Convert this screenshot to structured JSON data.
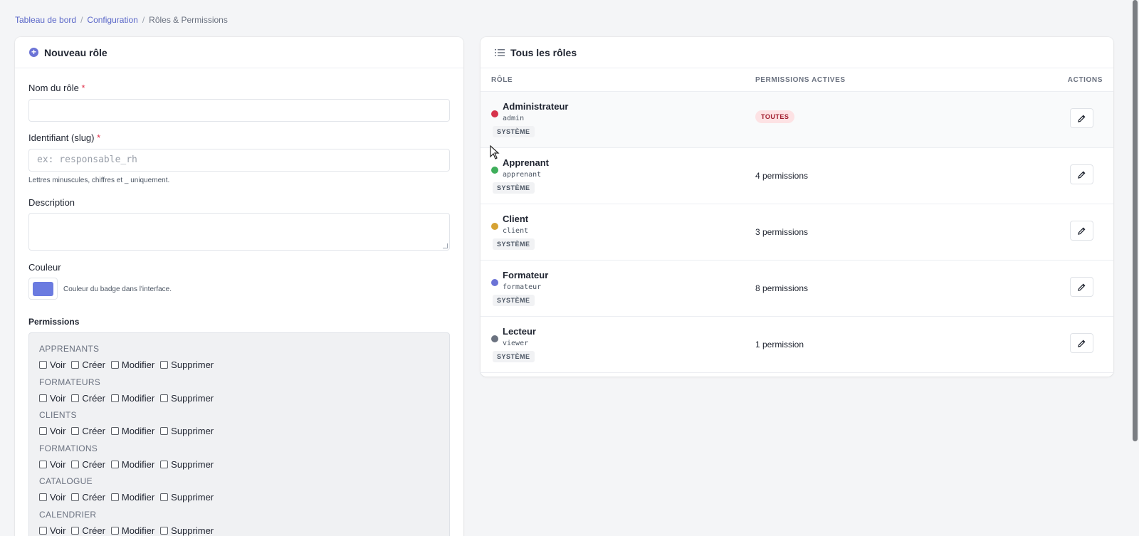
{
  "breadcrumb": {
    "items": [
      "Tableau de bord",
      "Configuration",
      "Rôles & Permissions"
    ],
    "separator": "/"
  },
  "left_card": {
    "title": "Nouveau rôle",
    "icon": "plus-circle-icon",
    "fields": {
      "name": {
        "label": "Nom du rôle",
        "required": "*",
        "value": ""
      },
      "slug": {
        "label": "Identifiant (slug)",
        "required": "*",
        "placeholder": "ex: responsable_rh",
        "hint": "Lettres minuscules, chiffres et _ uniquement."
      },
      "description": {
        "label": "Description",
        "value": ""
      },
      "color": {
        "label": "Couleur",
        "value": "#6b7be0",
        "hint": "Couleur du badge dans l'interface."
      }
    },
    "permissions": {
      "title": "Permissions",
      "actions": [
        "Voir",
        "Créer",
        "Modifier",
        "Supprimer"
      ],
      "groups": [
        "APPRENANTS",
        "FORMATEURS",
        "CLIENTS",
        "FORMATIONS",
        "CATALOGUE",
        "CALENDRIER"
      ]
    }
  },
  "right_card": {
    "title": "Tous les rôles",
    "icon": "list-icon",
    "columns": [
      "RÔLE",
      "PERMISSIONS ACTIVES",
      "ACTIONS"
    ],
    "rows": [
      {
        "name": "Administrateur",
        "slug": "admin",
        "badge": "SYSTÈME",
        "permissions": "TOUTES",
        "color": "#d6334b"
      },
      {
        "name": "Apprenant",
        "slug": "apprenant",
        "badge": "SYSTÈME",
        "permissions": "4 permissions",
        "color": "#3fae5b"
      },
      {
        "name": "Client",
        "slug": "client",
        "badge": "SYSTÈME",
        "permissions": "3 permissions",
        "color": "#d6a233"
      },
      {
        "name": "Formateur",
        "slug": "formateur",
        "badge": "SYSTÈME",
        "permissions": "8 permissions",
        "color": "#6b73d6"
      },
      {
        "name": "Lecteur",
        "slug": "viewer",
        "badge": "SYSTÈME",
        "permissions": "1 permission",
        "color": "#6b7280"
      }
    ]
  },
  "colors": {
    "accent": "#5a67c8",
    "required": "#e0314b"
  }
}
